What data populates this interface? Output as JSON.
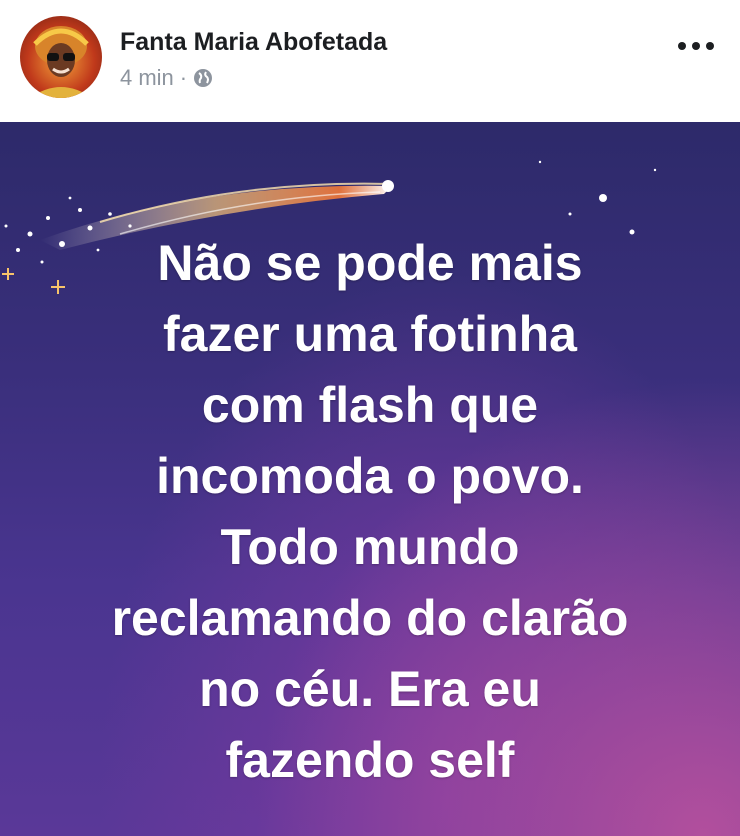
{
  "post": {
    "author_name": "Fanta Maria Abofetada",
    "timestamp": "4 min",
    "separator": "·",
    "privacy_icon": "globe-icon",
    "more_icon": "more-options-icon",
    "text_lines": [
      "Não se pode mais",
      "fazer uma fotinha",
      "com flash que",
      "incomoda o povo.",
      "Todo mundo",
      "reclamando do clarão",
      "no céu. Era eu",
      "fazendo self"
    ]
  },
  "colors": {
    "background_top": "#2d2a6a",
    "background_bottom": "#5a3898",
    "glow": "#b24f9d",
    "text": "#ffffff",
    "name": "#1c1e21",
    "meta": "#8d949e"
  }
}
